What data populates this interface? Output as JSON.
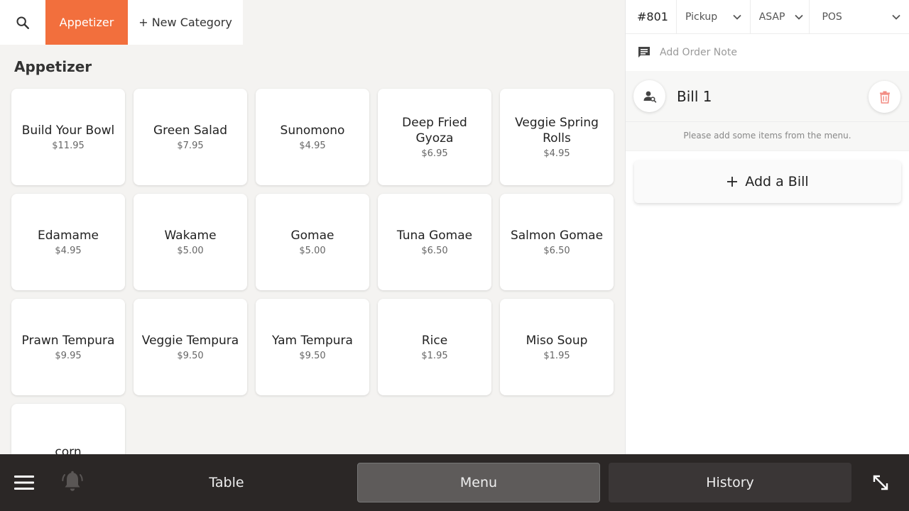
{
  "categories": {
    "search_icon": "search-icon",
    "active_label": "Appetizer",
    "new_label": "+ New Category",
    "active_color": "#f26f3d"
  },
  "section": {
    "title": "Appetizer"
  },
  "items": [
    {
      "name": "Build Your Bowl",
      "price": "$11.95"
    },
    {
      "name": "Green Salad",
      "price": "$7.95"
    },
    {
      "name": "Sunomono",
      "price": "$4.95"
    },
    {
      "name": "Deep Fried Gyoza",
      "price": "$6.95"
    },
    {
      "name": "Veggie Spring Rolls",
      "price": "$4.95"
    },
    {
      "name": "Edamame",
      "price": "$4.95"
    },
    {
      "name": "Wakame",
      "price": "$5.00"
    },
    {
      "name": "Gomae",
      "price": "$5.00"
    },
    {
      "name": "Tuna Gomae",
      "price": "$6.50"
    },
    {
      "name": "Salmon Gomae",
      "price": "$6.50"
    },
    {
      "name": "Prawn Tempura",
      "price": "$9.95"
    },
    {
      "name": "Veggie Tempura",
      "price": "$9.50"
    },
    {
      "name": "Yam Tempura",
      "price": "$9.50"
    },
    {
      "name": "Rice",
      "price": "$1.95"
    },
    {
      "name": "Miso Soup",
      "price": "$1.95"
    },
    {
      "name": "corn",
      "price": ""
    }
  ],
  "order": {
    "number": "#801",
    "type": "Pickup",
    "time": "ASAP",
    "channel": "POS",
    "note_placeholder": "Add Order Note"
  },
  "bill": {
    "title": "Bill 1",
    "empty_message": "Please add some items from the menu.",
    "delete_color": "#f28b82"
  },
  "add_bill": {
    "label": "Add a Bill"
  },
  "nav": {
    "table": "Table",
    "menu": "Menu",
    "history": "History"
  }
}
